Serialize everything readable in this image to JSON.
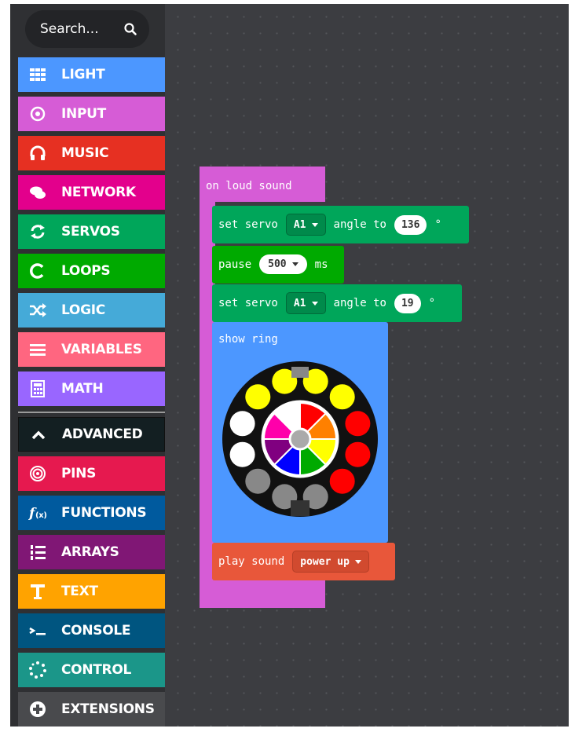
{
  "search": {
    "placeholder": "Search..."
  },
  "categories": [
    {
      "label": "LIGHT",
      "icon": "grid-icon",
      "color": "#4c97ff"
    },
    {
      "label": "INPUT",
      "icon": "target-icon",
      "color": "#d65cd6"
    },
    {
      "label": "MUSIC",
      "icon": "headphones-icon",
      "color": "#e63022"
    },
    {
      "label": "NETWORK",
      "icon": "chat-bubbles-icon",
      "color": "#e3008c"
    },
    {
      "label": "SERVOS",
      "icon": "refresh-icon",
      "color": "#00a65a"
    },
    {
      "label": "LOOPS",
      "icon": "loop-icon",
      "color": "#00aa00"
    },
    {
      "label": "LOGIC",
      "icon": "shuffle-icon",
      "color": "#45aad8"
    },
    {
      "label": "VARIABLES",
      "icon": "list-icon",
      "color": "#ff6680"
    },
    {
      "label": "MATH",
      "icon": "calculator-icon",
      "color": "#9966ff"
    },
    {
      "label": "ADVANCED",
      "icon": "chevron-up-icon",
      "color": "#131f22"
    },
    {
      "label": "PINS",
      "icon": "pin-icon",
      "color": "#e6194f"
    },
    {
      "label": "FUNCTIONS",
      "icon": "function-icon",
      "color": "#005a9e"
    },
    {
      "label": "ARRAYS",
      "icon": "ordered-list-icon",
      "color": "#801775"
    },
    {
      "label": "TEXT",
      "icon": "text-t-icon",
      "color": "#ffa300"
    },
    {
      "label": "CONSOLE",
      "icon": "terminal-icon",
      "color": "#005580"
    },
    {
      "label": "CONTROL",
      "icon": "dotted-circle-icon",
      "color": "#1b9689"
    },
    {
      "label": "EXTENSIONS",
      "icon": "plus-circle-icon",
      "color": "#494a4d"
    }
  ],
  "blocks": {
    "event": {
      "label": "on loud sound",
      "color": "#d65cd6"
    },
    "servo1": {
      "prefix": "set servo",
      "pin": "A1",
      "middle": "angle to",
      "angle": "136",
      "unit": "°",
      "color": "#00a65a"
    },
    "pause": {
      "prefix": "pause",
      "value": "500",
      "unit": "ms",
      "color": "#00aa00"
    },
    "servo2": {
      "prefix": "set servo",
      "pin": "A1",
      "middle": "angle to",
      "angle": "19",
      "unit": "°",
      "color": "#00a65a"
    },
    "ring": {
      "label": "show ring",
      "color": "#4c97ff"
    },
    "sound": {
      "prefix": "play sound",
      "value": "power up",
      "color": "#e8573a"
    }
  },
  "ring_leds": [
    "#888888",
    "#ffffff",
    "#ffffff",
    "#ffff00",
    "#ffff00",
    "#ffff00",
    "#ffff00",
    "#ff0000",
    "#ff0000",
    "#ff0000",
    "#888888",
    "#888888"
  ],
  "color_wheel": [
    "#ff0000",
    "#ff8000",
    "#ffff00",
    "#00aa00",
    "#0000ff",
    "#800080",
    "#ff00aa",
    "#ffffff"
  ]
}
